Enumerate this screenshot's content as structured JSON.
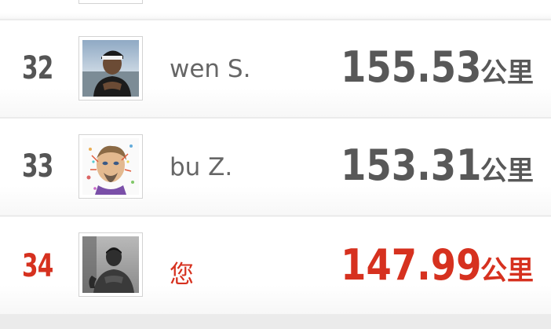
{
  "leaderboard": {
    "rows": [
      {
        "rank": "32",
        "name": "wen S.",
        "distance": "155.53",
        "unit": "公里",
        "avatar": "profile-photo-man-cap"
      },
      {
        "rank": "33",
        "name": "bu Z.",
        "distance": "153.31",
        "unit": "公里",
        "avatar": "profile-illustration-colorful-face"
      },
      {
        "rank": "34",
        "name": "您",
        "distance": "147.99",
        "unit": "公里",
        "avatar": "profile-photo-self",
        "highlighted": true
      }
    ]
  },
  "colors": {
    "text_default": "#585858",
    "text_highlight": "#d6311f",
    "row_background": "#ffffff",
    "separator": "#ebebeb"
  }
}
